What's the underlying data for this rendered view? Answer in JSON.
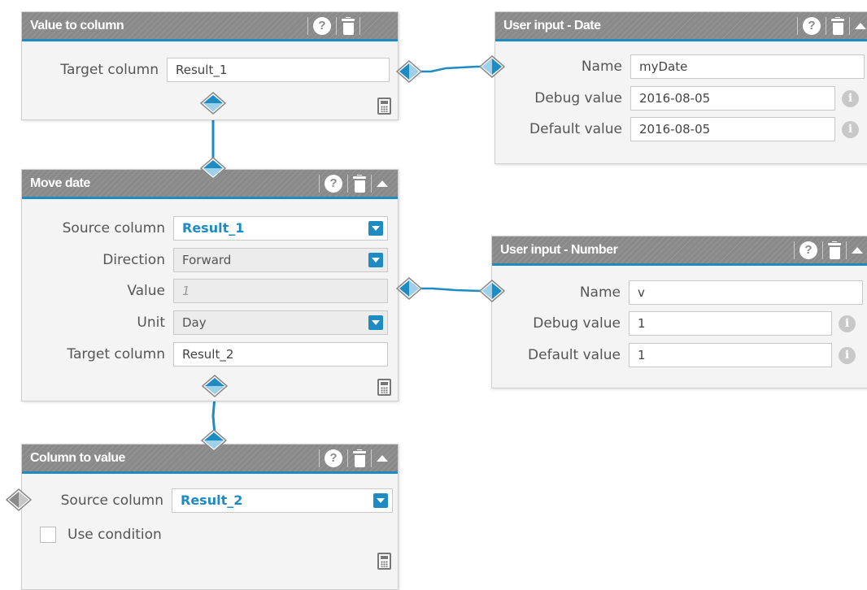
{
  "nodes": {
    "value_to_column": {
      "title": "Value to column",
      "target_column_label": "Target column",
      "target_column_value": "Result_1"
    },
    "user_input_date": {
      "title": "User input - Date",
      "name_label": "Name",
      "name_value": "myDate",
      "debug_label": "Debug value",
      "debug_value": "2016-08-05",
      "default_label": "Default value",
      "default_value": "2016-08-05"
    },
    "move_date": {
      "title": "Move date",
      "source_column_label": "Source column",
      "source_column_value": "Result_1",
      "direction_label": "Direction",
      "direction_value": "Forward",
      "value_label": "Value",
      "value_placeholder": "1",
      "unit_label": "Unit",
      "unit_value": "Day",
      "target_column_label": "Target column",
      "target_column_value": "Result_2"
    },
    "user_input_number": {
      "title": "User input - Number",
      "name_label": "Name",
      "name_value": "v",
      "debug_label": "Debug value",
      "debug_value": "1",
      "default_label": "Default value",
      "default_value": "1"
    },
    "column_to_value": {
      "title": "Column to value",
      "source_column_label": "Source column",
      "source_column_value": "Result_2",
      "use_condition_label": "Use condition",
      "use_condition_checked": false
    }
  },
  "icons": {
    "help": "?",
    "info": "i",
    "trash": "trash-icon",
    "collapse": "chevron-up-icon",
    "calculator": "calculator-icon"
  },
  "colors": {
    "accent": "#1e8bc3",
    "header": "#8a8a8a",
    "port_grey": "#8a8a8a"
  }
}
